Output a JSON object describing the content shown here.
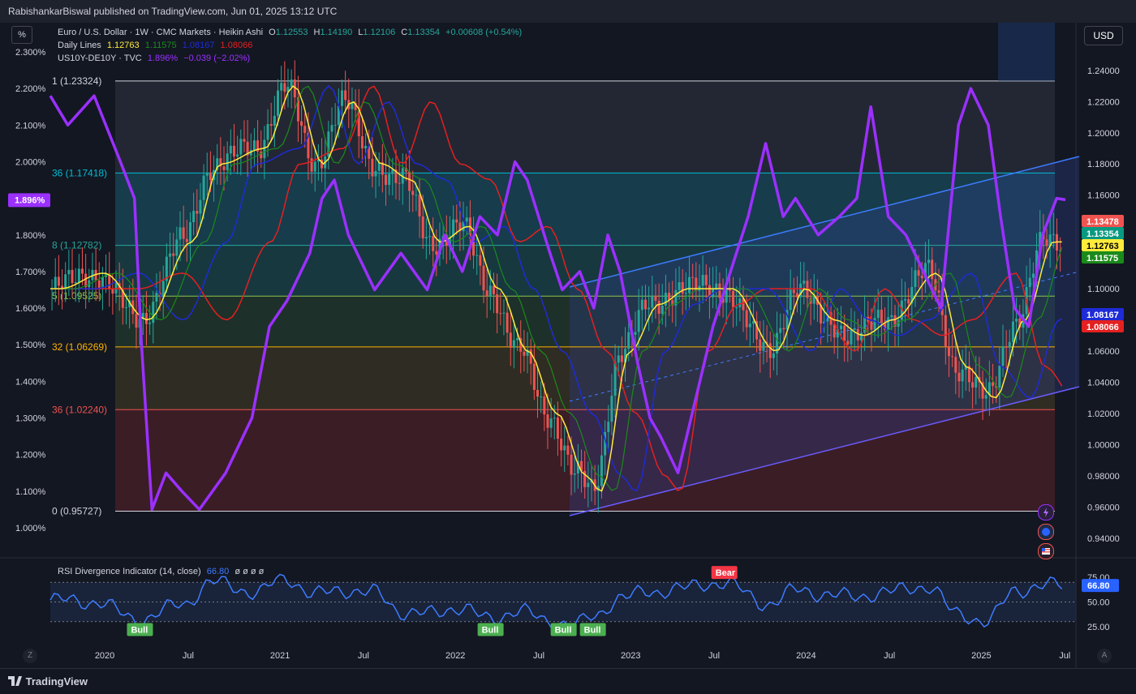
{
  "header": {
    "publisher_line": "RabishankarBiswal published on TradingView.com, Jun 01, 2025 13:12 UTC"
  },
  "controls": {
    "percent_label": "%",
    "currency_label": "USD"
  },
  "legend": {
    "line1": {
      "symbol": "Euro / U.S. Dollar · 1W · CMC Markets · Heikin Ashi",
      "o_label": "O",
      "o": "1.12553",
      "h_label": "H",
      "h": "1.14190",
      "l_label": "L",
      "l": "1.12106",
      "c_label": "C",
      "c": "1.13354",
      "chg": "+0.00608 (+0.54%)"
    },
    "line2": {
      "name": "Daily Lines",
      "v1": "1.12763",
      "v2": "1.11575",
      "v3": "1.08167",
      "v4": "1.08066"
    },
    "line3": {
      "name": "US10Y-DE10Y · TVC",
      "v1": "1.896%",
      "v2": "−0.039 (−2.02%)"
    }
  },
  "rsi": {
    "title": "RSI Divergence Indicator (14, close)",
    "value": "66.80",
    "extras": "ø ø ø ø",
    "bull_label": "Bull",
    "bear_label": "Bear"
  },
  "footer": {
    "brand": "TradingView",
    "left_corner": "Z",
    "right_corner": "A"
  },
  "colors": {
    "bg": "#131722",
    "purple": "#9b30ff",
    "yellow": "#ffeb3b",
    "green": "#1b8a1b",
    "blue": "#1e2bd6",
    "red": "#e52020",
    "up": "#26a69a",
    "down": "#ef5350",
    "channel": "#3d7bff"
  },
  "chart_data": [
    {
      "type": "line",
      "title": "Euro / U.S. Dollar · 1W · CMC Markets · Heikin Ashi",
      "x_ticks": [
        "2020",
        "Jul",
        "2021",
        "Jul",
        "2022",
        "Jul",
        "2023",
        "Jul",
        "2024",
        "Jul",
        "2025",
        "Jul"
      ],
      "right_axis": {
        "ticks": [
          "1.24000",
          "1.22000",
          "1.20000",
          "1.18000",
          "1.16000",
          "1.14000",
          "1.12000",
          "1.10000",
          "1.08000",
          "1.06000",
          "1.04000",
          "1.02000",
          "1.00000",
          "0.98000",
          "0.96000",
          "0.94000"
        ],
        "range": [
          0.93,
          1.255
        ]
      },
      "left_axis": {
        "ticks": [
          "2.300%",
          "2.200%",
          "2.100%",
          "2.000%",
          "1.900%",
          "1.800%",
          "1.700%",
          "1.600%",
          "1.500%",
          "1.400%",
          "1.300%",
          "1.200%",
          "1.100%",
          "1.000%"
        ]
      },
      "price_labels": [
        {
          "value": "1.13478",
          "color": "#ef5350",
          "text_color": "#ffffff"
        },
        {
          "value": "1.13354",
          "color": "#089981",
          "text_color": "#ffffff"
        },
        {
          "value": "1.12763",
          "color": "#ffeb3b",
          "text_color": "#000000"
        },
        {
          "value": "1.11575",
          "color": "#1b8a1b",
          "text_color": "#ffffff"
        },
        {
          "value": "1.08167",
          "color": "#1e2bd6",
          "text_color": "#ffffff"
        },
        {
          "value": "1.08066",
          "color": "#e52020",
          "text_color": "#ffffff"
        }
      ],
      "left_price_label": {
        "value": "1.896%",
        "color": "#9b30ff"
      },
      "fib_levels": [
        {
          "label": "1 (1.23324)",
          "value": 1.23324,
          "color": "#d1d4dc",
          "fill": "#2a2e39"
        },
        {
          "label": "36 (1.17418)",
          "value": 1.17418,
          "color": "#00bcd4",
          "fill": "#1a4a5a"
        },
        {
          "label": "8 (1.12782)",
          "value": 1.12782,
          "color": "#26a69a",
          "fill": "#19444a"
        },
        {
          "label": "5 (1.09525)",
          "value": 1.09525,
          "color": "#8bc34a",
          "fill": "#233a2e"
        },
        {
          "label": "32 (1.06269)",
          "value": 1.06269,
          "color": "#ffb300",
          "fill": "#3a3424"
        },
        {
          "label": "36 (1.02240)",
          "value": 1.0224,
          "color": "#ef5350",
          "fill": "#4a2028"
        },
        {
          "label": "0 (0.95727)",
          "value": 0.95727,
          "color": "#d1d4dc",
          "fill": null
        }
      ],
      "series": [
        {
          "name": "Euro / U.S. Dollar",
          "style": "heikin-ashi",
          "x": [
            "2019-09",
            "2019-12",
            "2020-03",
            "2020-06",
            "2020-08",
            "2020-11",
            "2021-01",
            "2021-03",
            "2021-05",
            "2021-07",
            "2021-09",
            "2021-11",
            "2022-01",
            "2022-03",
            "2022-05",
            "2022-07",
            "2022-09",
            "2022-10",
            "2022-12",
            "2023-02",
            "2023-04",
            "2023-07",
            "2023-10",
            "2023-12",
            "2024-02",
            "2024-04",
            "2024-06",
            "2024-09",
            "2024-11",
            "2025-01",
            "2025-03",
            "2025-05"
          ],
          "y": [
            1.1,
            1.11,
            1.08,
            1.13,
            1.18,
            1.19,
            1.23,
            1.18,
            1.22,
            1.18,
            1.17,
            1.13,
            1.14,
            1.1,
            1.06,
            1.02,
            0.98,
            0.97,
            1.06,
            1.09,
            1.1,
            1.1,
            1.06,
            1.1,
            1.08,
            1.07,
            1.08,
            1.11,
            1.05,
            1.03,
            1.08,
            1.13
          ]
        }
      ]
    },
    {
      "type": "line",
      "title": "RSI Divergence Indicator (14, close)",
      "right_axis": {
        "ticks": [
          "75.00",
          "50.00",
          "25.00"
        ],
        "range": [
          15,
          85
        ]
      },
      "bands": [
        70,
        50,
        30
      ],
      "series": [
        {
          "x": [
            "2019-09",
            "2019-12",
            "2020-03",
            "2020-06",
            "2020-08",
            "2020-11",
            "2021-01",
            "2021-03",
            "2021-05",
            "2021-07",
            "2021-09",
            "2021-11",
            "2022-01",
            "2022-03",
            "2022-05",
            "2022-07",
            "2022-09",
            "2022-10",
            "2022-12",
            "2023-02",
            "2023-04",
            "2023-07",
            "2023-10",
            "2023-12",
            "2024-02",
            "2024-04",
            "2024-06",
            "2024-09",
            "2024-11",
            "2025-01",
            "2025-03",
            "2025-05"
          ],
          "y": [
            52,
            50,
            32,
            48,
            70,
            60,
            74,
            58,
            62,
            60,
            40,
            38,
            45,
            32,
            42,
            30,
            28,
            34,
            55,
            60,
            64,
            70,
            48,
            62,
            58,
            55,
            60,
            66,
            38,
            30,
            62,
            66.8
          ]
        }
      ],
      "signals": [
        {
          "label": "Bull",
          "at": "2020-03"
        },
        {
          "label": "Bull",
          "at": "2022-03"
        },
        {
          "label": "Bull",
          "at": "2022-08"
        },
        {
          "label": "Bull",
          "at": "2022-10"
        },
        {
          "label": "Bear",
          "at": "2023-07"
        }
      ]
    }
  ]
}
